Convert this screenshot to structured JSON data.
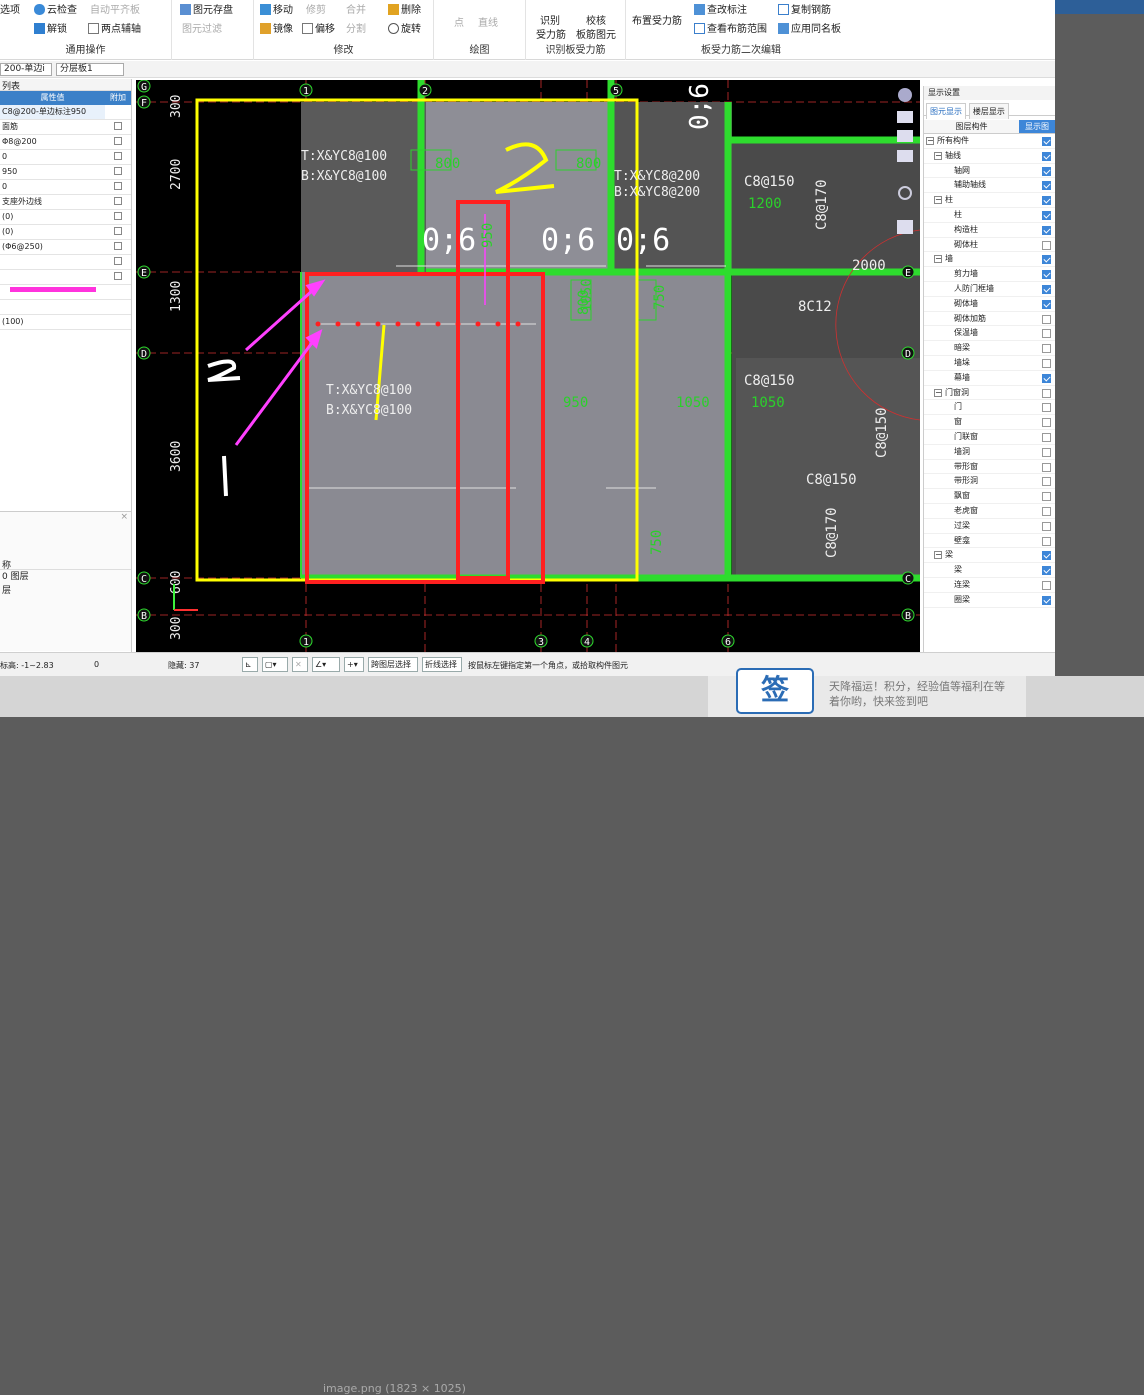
{
  "ribbon": {
    "g1": {
      "a": "选项",
      "b": "云检查",
      "c": "自动平齐板",
      "d": "图元存盘",
      "e": "解锁",
      "f": "两点辅轴",
      "g": "图元过滤",
      "label": "通用操作"
    },
    "g2": {
      "a": "移动",
      "b": "修剪",
      "c": "合并",
      "d": "删除",
      "e": "镜像",
      "f": "偏移",
      "g": "分割",
      "h": "旋转",
      "label": "修改"
    },
    "g3": {
      "a": "点",
      "b": "直线",
      "label": "绘图"
    },
    "g4": {
      "a": "识别",
      "b": "受力筋",
      "c": "校核",
      "d": "板筋图元",
      "label": "识别板受力筋"
    },
    "g5": {
      "a": "布置受力筋",
      "b": "查改标注",
      "c": "复制钢筋",
      "d": "查看布筋范围",
      "e": "应用同名板",
      "label": "板受力筋二次编辑"
    }
  },
  "toolbar2": {
    "sel1": "200-单边i",
    "sel2": "分层板1"
  },
  "props": {
    "tab": "列表",
    "col_value": "属性值",
    "col_extra": "附加",
    "rows": [
      "C8@200-单边标注950",
      "面筋",
      "Φ8@200",
      "0",
      "950",
      "0",
      "支座外边线",
      "(0)",
      "(0)",
      "(Φ6@250)",
      "",
      "",
      "",
      "",
      "(100)"
    ],
    "bottom": {
      "col": "称",
      "r1": "0 图层",
      "r2": "层"
    }
  },
  "canvas": {
    "axes_top": [
      "1",
      "2",
      "5"
    ],
    "axes_bottom": [
      "1",
      "3",
      "4",
      "6"
    ],
    "axes_left": [
      "G",
      "F",
      "E",
      "D",
      "C",
      "B"
    ],
    "axes_right": [
      "E",
      "D",
      "C",
      "B"
    ],
    "dims": [
      "300",
      "2700",
      "1300",
      "3600",
      "600",
      "300"
    ],
    "slab_texts": [
      "T:X&YC8@100",
      "B:X&YC8@100",
      "T:X&YC8@200",
      "B:X&YC8@200",
      "T:X&YC8@100",
      "B:X&YC8@100"
    ],
    "rebar_labels": [
      "C8@150",
      "C8@170",
      "C8@150",
      "C8@150",
      "C8@170",
      "C8@150",
      "8C12"
    ],
    "dim_marks": [
      "800",
      "800",
      "1200",
      "2000",
      "950",
      "1050",
      "1050",
      "750",
      "800",
      "950",
      "1050",
      "750"
    ],
    "annotations": [
      "0;6",
      "0;6",
      "0;6",
      "0;6",
      "2",
      "2",
      "1",
      "1"
    ]
  },
  "display": {
    "title": "显示设置",
    "tab1": "图元显示",
    "tab2": "楼层显示",
    "col1": "图层构件",
    "col2": "显示图",
    "rows": [
      {
        "label": "所有构件",
        "level": 0,
        "on": true
      },
      {
        "label": "轴线",
        "level": 1,
        "on": true
      },
      {
        "label": "轴网",
        "level": 2,
        "on": true
      },
      {
        "label": "辅助轴线",
        "level": 2,
        "on": true
      },
      {
        "label": "柱",
        "level": 1,
        "on": true
      },
      {
        "label": "柱",
        "level": 2,
        "on": true
      },
      {
        "label": "构造柱",
        "level": 2,
        "on": true
      },
      {
        "label": "砌体柱",
        "level": 2,
        "on": false
      },
      {
        "label": "墙",
        "level": 1,
        "on": true
      },
      {
        "label": "剪力墙",
        "level": 2,
        "on": true
      },
      {
        "label": "人防门框墙",
        "level": 2,
        "on": true
      },
      {
        "label": "砌体墙",
        "level": 2,
        "on": true
      },
      {
        "label": "砌体加筋",
        "level": 2,
        "on": false
      },
      {
        "label": "保温墙",
        "level": 2,
        "on": false
      },
      {
        "label": "暗梁",
        "level": 2,
        "on": false
      },
      {
        "label": "墙垛",
        "level": 2,
        "on": false
      },
      {
        "label": "幕墙",
        "level": 2,
        "on": true
      },
      {
        "label": "门窗洞",
        "level": 1,
        "on": false
      },
      {
        "label": "门",
        "level": 2,
        "on": false
      },
      {
        "label": "窗",
        "level": 2,
        "on": false
      },
      {
        "label": "门联窗",
        "level": 2,
        "on": false
      },
      {
        "label": "墙洞",
        "level": 2,
        "on": false
      },
      {
        "label": "带形窗",
        "level": 2,
        "on": false
      },
      {
        "label": "带形洞",
        "level": 2,
        "on": false
      },
      {
        "label": "飘窗",
        "level": 2,
        "on": false
      },
      {
        "label": "老虎窗",
        "level": 2,
        "on": false
      },
      {
        "label": "过梁",
        "level": 2,
        "on": false
      },
      {
        "label": "壁龛",
        "level": 2,
        "on": false
      },
      {
        "label": "梁",
        "level": 1,
        "on": true
      },
      {
        "label": "梁",
        "level": 2,
        "on": true
      },
      {
        "label": "连梁",
        "level": 2,
        "on": false
      },
      {
        "label": "圈梁",
        "level": 2,
        "on": true
      }
    ]
  },
  "status": {
    "elev": "标高: -1~2.83",
    "zero": "0",
    "hidden": "隐藏: 37",
    "btn1": "跨图层选择",
    "btn2": "折线选择",
    "hint": "按鼠标左键指定第一个角点，或拾取构件图元"
  },
  "forum": {
    "sign_icon": "签",
    "sign_text": "天降福运！积分，经验值等福利在等着你哟，快来签到吧",
    "caption": "image.png (1823 × 1025)"
  }
}
